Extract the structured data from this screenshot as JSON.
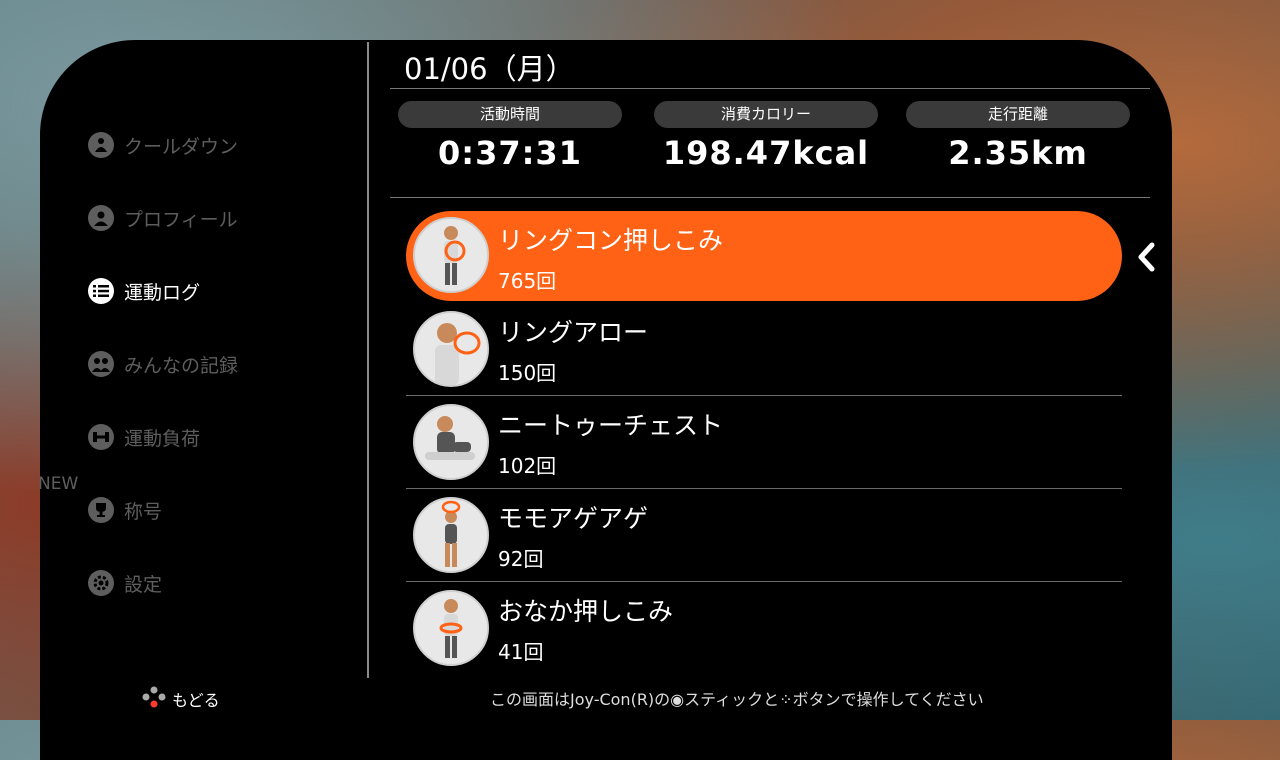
{
  "sidebar": {
    "new_label": "NEW",
    "items": [
      {
        "label": "クールダウン",
        "icon": "cooldown-icon",
        "active": false
      },
      {
        "label": "プロフィール",
        "icon": "profile-icon",
        "active": false
      },
      {
        "label": "運動ログ",
        "icon": "list-icon",
        "active": true
      },
      {
        "label": "みんなの記録",
        "icon": "group-icon",
        "active": false
      },
      {
        "label": "運動負荷",
        "icon": "dumbbell-icon",
        "active": false
      },
      {
        "label": "称号",
        "icon": "trophy-icon",
        "active": false
      },
      {
        "label": "設定",
        "icon": "gear-icon",
        "active": false
      }
    ]
  },
  "header": {
    "date": "01/06（月）"
  },
  "stats": [
    {
      "label": "活動時間",
      "value": "0:37:31"
    },
    {
      "label": "消費カロリー",
      "value": "198.47kcal"
    },
    {
      "label": "走行距離",
      "value": "2.35km"
    }
  ],
  "exercises": [
    {
      "name": "リングコン押しこみ",
      "count": "765回"
    },
    {
      "name": "リングアロー",
      "count": "150回"
    },
    {
      "name": "ニートゥーチェスト",
      "count": "102回"
    },
    {
      "name": "モモアゲアゲ",
      "count": "92回"
    },
    {
      "name": "おなか押しこみ",
      "count": "41回"
    }
  ],
  "footer": {
    "back_label": "もどる",
    "hint": "この画面はJoy-Con(R)の◉スティックと⁘ボタンで操作してください"
  },
  "colors": {
    "accent": "#ff6214",
    "panel": "#000000",
    "inactive": "#5e5e5e"
  }
}
